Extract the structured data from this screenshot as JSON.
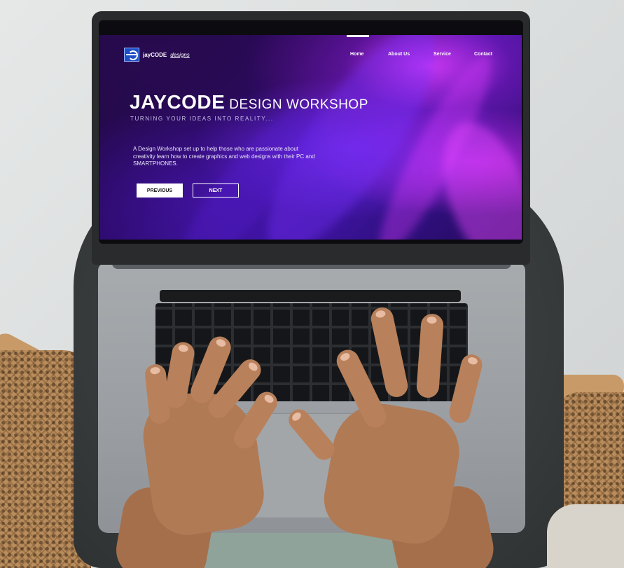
{
  "screen": {
    "logo": {
      "name": "jayCODE",
      "name_suffix": "designs"
    },
    "nav": {
      "home": "Home",
      "about": "About Us",
      "service": "Service",
      "contact": "Contact"
    },
    "hero": {
      "title_main": "JAYCODE",
      "title_sub": "DESIGN WORKSHOP",
      "tagline": "TURNING YOUR IDEAS INTO REALITY...",
      "description": "A Design Workshop set up to help those who are passionate about creativity learn how to create graphics and web designs with their PC and SMARTPHONES.",
      "previous_label": "PREVIOUS",
      "next_label": "NEXT"
    }
  }
}
